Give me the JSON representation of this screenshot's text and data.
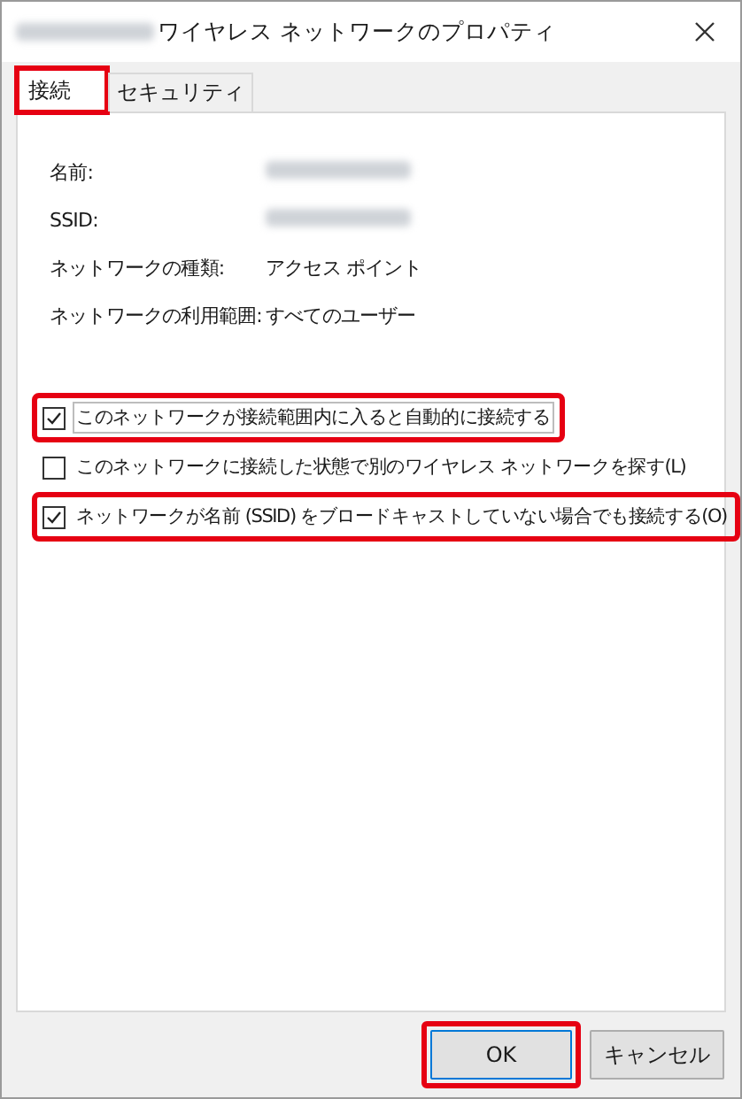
{
  "window": {
    "title": "ワイヤレス ネットワークのプロパティ",
    "title_prefix_redacted": true
  },
  "tabs": [
    {
      "label": "接続",
      "selected": true,
      "highlighted": true
    },
    {
      "label": "セキュリティ",
      "selected": false,
      "highlighted": false
    }
  ],
  "properties": [
    {
      "label": "名前:",
      "kind": "redacted"
    },
    {
      "label": "SSID:",
      "kind": "redacted"
    },
    {
      "label": "ネットワークの種類:",
      "kind": "text",
      "value": "アクセス ポイント"
    },
    {
      "label": "ネットワークの利用範囲:",
      "kind": "text",
      "value": "すべてのユーザー"
    }
  ],
  "options": [
    {
      "label": "このネットワークが接続範囲内に入ると自動的に接続する",
      "checked": true,
      "focused": true,
      "highlighted": true
    },
    {
      "label": "このネットワークに接続した状態で別のワイヤレス ネットワークを探す(L)",
      "checked": false,
      "focused": false,
      "highlighted": false
    },
    {
      "label": "ネットワークが名前 (SSID) をブロードキャストしていない場合でも接続する(O)",
      "checked": true,
      "focused": false,
      "highlighted": true
    }
  ],
  "buttons": [
    {
      "label": "OK",
      "default": true,
      "highlighted": true
    },
    {
      "label": "キャンセル",
      "default": false,
      "highlighted": false
    }
  ]
}
